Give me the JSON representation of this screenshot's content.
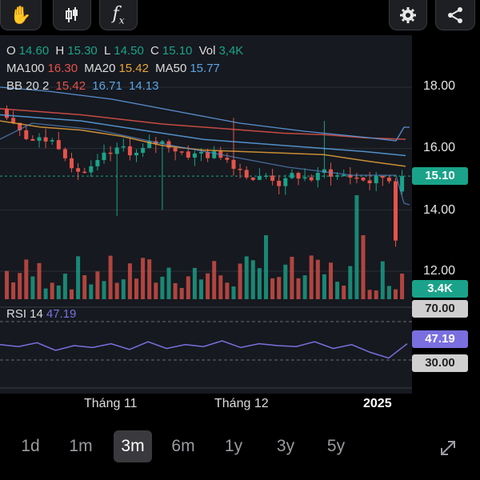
{
  "toolbar": {
    "left_icons": [
      "hand-icon",
      "candlestick-icon",
      "function-icon"
    ],
    "right_icons": [
      "gear-icon",
      "share-icon"
    ]
  },
  "ohlc": {
    "o_label": "O",
    "o_value": "14.60",
    "h_label": "H",
    "h_value": "15.30",
    "l_label": "L",
    "l_value": "14.50",
    "c_label": "C",
    "c_value": "15.10",
    "vol_label": "Vol",
    "vol_value": "3,4K"
  },
  "ma": {
    "ma100_label": "MA100",
    "ma100_value": "16.30",
    "ma20_label": "MA20",
    "ma20_value": "15.42",
    "ma50_label": "MA50",
    "ma50_value": "15.77"
  },
  "bb": {
    "label": "BB 20 2",
    "mid": "15.42",
    "upper": "16.71",
    "lower": "14.13"
  },
  "price_axis": [
    "18.00",
    "16.00",
    "14.00",
    "12.00"
  ],
  "price_tag": "15.10",
  "volume_tag": "3.4K",
  "rsi": {
    "label": "RSI 14",
    "value": "47.19",
    "level_high": "70.00",
    "level_low": "30.00",
    "tag": "47.19"
  },
  "time_axis": [
    "Tháng 11",
    "Tháng 12",
    "2025"
  ],
  "periods": [
    "1d",
    "1m",
    "3m",
    "6m",
    "1y",
    "3y",
    "5y"
  ],
  "active_period": "3m",
  "colors": {
    "up": "#1aa38a",
    "down": "#e5534b",
    "ma20": "#e8a33a",
    "ma50": "#5ba4e6",
    "bb_upper": "#5a8fd0",
    "rsi": "#7a6fe0",
    "price_tag_bg": "#1aa38a"
  },
  "chart_data": {
    "type": "line",
    "series": [
      {
        "name": "MA100",
        "values": [
          17.3,
          17.2,
          17.1,
          16.95,
          16.8,
          16.7,
          16.6,
          16.5,
          16.45,
          16.35,
          16.3
        ]
      },
      {
        "name": "MA20",
        "values": [
          16.9,
          16.7,
          16.6,
          16.4,
          16.1,
          15.95,
          15.9,
          15.85,
          15.8,
          15.6,
          15.42
        ]
      },
      {
        "name": "MA50",
        "values": [
          17.1,
          17.0,
          16.9,
          16.7,
          16.5,
          16.3,
          16.2,
          16.1,
          16.0,
          15.9,
          15.77
        ]
      }
    ],
    "ylim": [
      11.5,
      19.0
    ],
    "rsi_values": [
      46,
      44,
      48,
      40,
      45,
      43,
      47,
      41,
      49,
      42,
      46,
      44,
      50,
      43,
      47,
      45,
      44,
      49,
      42,
      46,
      38,
      32,
      47
    ]
  }
}
